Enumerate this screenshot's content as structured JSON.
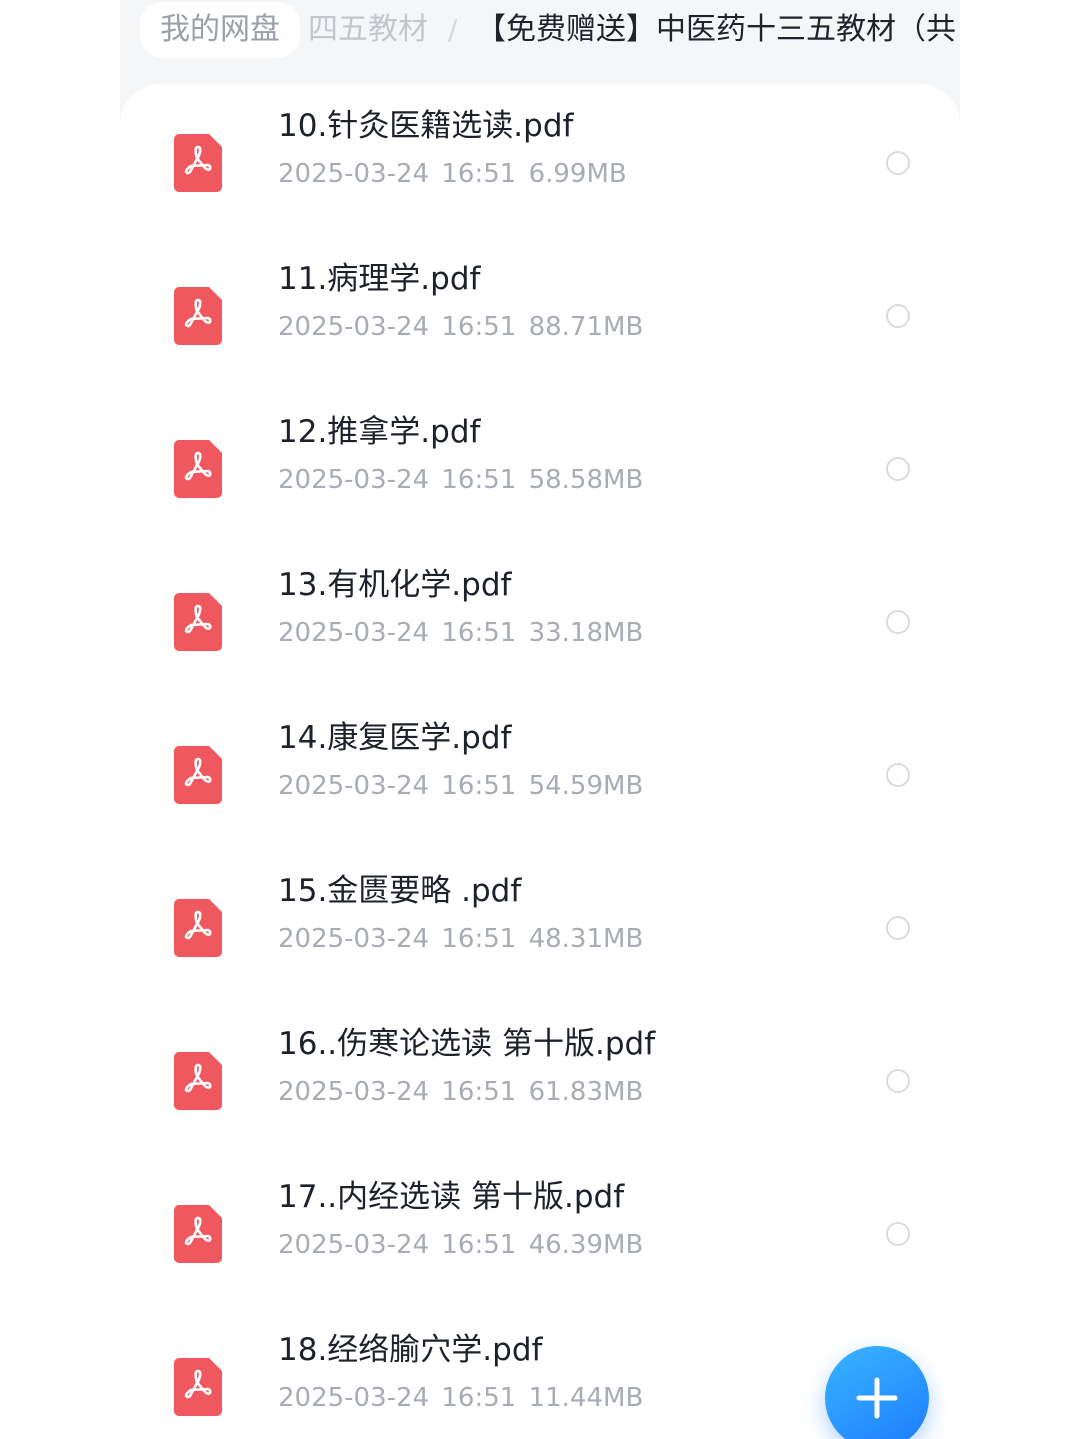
{
  "breadcrumb": {
    "home": "我的网盘",
    "middle": "四五教材",
    "separator": "/",
    "current": "【免费赠送】中医药十三五教材（共"
  },
  "files": [
    {
      "name": "10.针灸医籍选读.pdf",
      "date": "2025-03-24",
      "time": "16:51",
      "size": "6.99MB",
      "icon": "pdf-file-icon"
    },
    {
      "name": "11.病理学.pdf",
      "date": "2025-03-24",
      "time": "16:51",
      "size": "88.71MB",
      "icon": "pdf-file-icon"
    },
    {
      "name": "12.推拿学.pdf",
      "date": "2025-03-24",
      "time": "16:51",
      "size": "58.58MB",
      "icon": "pdf-file-icon"
    },
    {
      "name": "13.有机化学.pdf",
      "date": "2025-03-24",
      "time": "16:51",
      "size": "33.18MB",
      "icon": "pdf-file-icon"
    },
    {
      "name": "14.康复医学.pdf",
      "date": "2025-03-24",
      "time": "16:51",
      "size": "54.59MB",
      "icon": "pdf-file-icon"
    },
    {
      "name": "15.金匮要略 .pdf",
      "date": "2025-03-24",
      "time": "16:51",
      "size": "48.31MB",
      "icon": "pdf-file-icon"
    },
    {
      "name": "16..伤寒论选读 第十版.pdf",
      "date": "2025-03-24",
      "time": "16:51",
      "size": "61.83MB",
      "icon": "pdf-file-icon"
    },
    {
      "name": "17..内经选读 第十版.pdf",
      "date": "2025-03-24",
      "time": "16:51",
      "size": "46.39MB",
      "icon": "pdf-file-icon"
    },
    {
      "name": "18.经络腧穴学.pdf",
      "date": "2025-03-24",
      "time": "16:51",
      "size": "11.44MB",
      "icon": "pdf-file-icon"
    }
  ],
  "fab": {
    "icon": "plus-icon"
  },
  "colors": {
    "pdf_icon": "#f0585f",
    "fab_start": "#39b5ff",
    "fab_end": "#1d7bff",
    "title_text": "#1d2129",
    "meta_text": "#a8acb3"
  }
}
